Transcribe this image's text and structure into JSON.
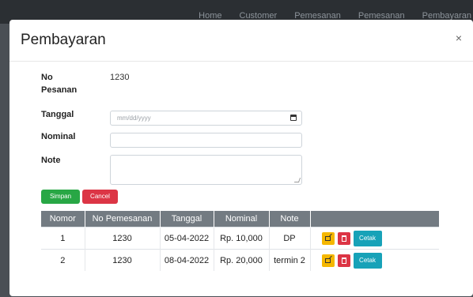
{
  "topnav": [
    "Home",
    "Customer",
    "Pemesanan",
    "Pemesanan",
    "Pembayaran"
  ],
  "modal": {
    "title": "Pembayaran",
    "close": "×"
  },
  "form": {
    "no_pesanan_label": "No Pesanan",
    "no_pesanan_value": "1230",
    "tanggal_label": "Tanggal",
    "tanggal_placeholder": "mm/dd/yyyy",
    "nominal_label": "Nominal",
    "nominal_value": "",
    "note_label": "Note",
    "note_value": "",
    "simpan_label": "Simpan",
    "cancel_label": "Cancel"
  },
  "table": {
    "headers": [
      "Nomor",
      "No Pemesanan",
      "Tanggal",
      "Nominal",
      "Note",
      ""
    ],
    "rows": [
      {
        "nomor": "1",
        "no_pemesanan": "1230",
        "tanggal": "05-04-2022",
        "nominal": "Rp. 10,000",
        "note": "DP"
      },
      {
        "nomor": "2",
        "no_pemesanan": "1230",
        "tanggal": "08-04-2022",
        "nominal": "Rp. 20,000",
        "note": "termin 2"
      }
    ],
    "action_print_label": "Cetak"
  },
  "colors": {
    "header_bg": "#737b82",
    "success": "#28a745",
    "danger": "#dc3545",
    "warning": "#f5b700",
    "info": "#17a2b8"
  },
  "icons": [
    "close-icon",
    "calendar-icon",
    "resize-grip-icon",
    "edit-icon",
    "trash-icon"
  ]
}
